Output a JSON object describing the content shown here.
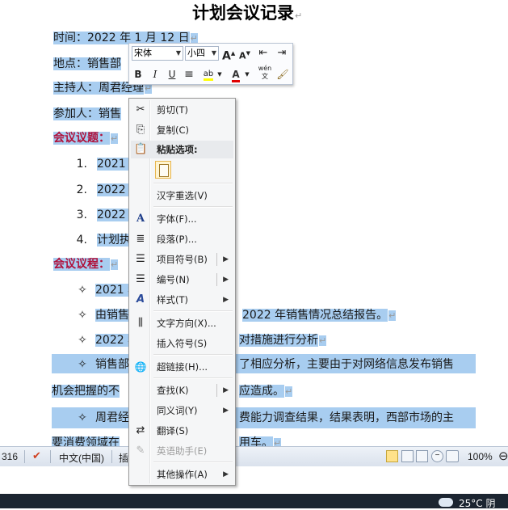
{
  "document": {
    "title": "计划会议记录",
    "time_line": "时间：2022 年 1 月 12 日",
    "location_line": "地点：销售部",
    "host_line": "主持人：周君经理",
    "attendees_line": "参加人：销售",
    "agenda_heading": "会议议题：",
    "agenda_items": [
      {
        "num": "1.",
        "text": "2021 年"
      },
      {
        "num": "2.",
        "text": "2022 年"
      },
      {
        "num": "3.",
        "text": "2022 年"
      },
      {
        "num": "4.",
        "text": "计划执"
      }
    ],
    "process_heading": "会议议程：",
    "process_items": [
      {
        "bullet": "✧",
        "text": "2021 年"
      },
      {
        "bullet": "✧",
        "text": "由销售部",
        "tail": "2022 年销售情况总结报告。"
      },
      {
        "bullet": "✧",
        "text": "2022 年",
        "tail": "对措施进行分析"
      },
      {
        "bullet": "✧",
        "text": "销售部",
        "tail": "了相应分析，主要由于对网络信息发布销售"
      },
      {
        "bullet": "",
        "text": "机会把握的不",
        "tail": "应造成。"
      },
      {
        "bullet": "✧",
        "text": "周君经",
        "tail": "费能力调查结果，结果表明，西部市场的主"
      },
      {
        "bullet": "",
        "text": "要消费领域在",
        "tail": "用车。"
      }
    ],
    "para_mark": "↵"
  },
  "mini_toolbar": {
    "font_name": "宋体",
    "font_size": "小四",
    "grow_font": "A",
    "shrink_font": "A",
    "bold": "B",
    "italic": "I",
    "underline": "U",
    "highlight": "ab",
    "font_color": "A",
    "phonetic": "wén",
    "format_painter": "🖌"
  },
  "context_menu": {
    "items": [
      {
        "label": "剪切(T)",
        "icon": "scissors-icon",
        "glyph": "✂"
      },
      {
        "label": "复制(C)",
        "icon": "copy-icon",
        "glyph": "⎘"
      },
      {
        "label": "粘贴选项:",
        "icon": "paste-icon",
        "glyph": "📋"
      },
      {
        "label": "汉字重选(V)"
      },
      {
        "label": "字体(F)...",
        "icon": "font-icon",
        "glyph": "A"
      },
      {
        "label": "段落(P)...",
        "icon": "paragraph-icon",
        "glyph": "≣"
      },
      {
        "label": "项目符号(B)",
        "icon": "bullets-icon",
        "glyph": "☰"
      },
      {
        "label": "编号(N)",
        "icon": "numbering-icon",
        "glyph": "☰"
      },
      {
        "label": "样式(T)",
        "icon": "styles-icon",
        "glyph": "A"
      },
      {
        "label": "文字方向(X)...",
        "icon": "text-direction-icon",
        "glyph": "⫼"
      },
      {
        "label": "插入符号(S)"
      },
      {
        "label": "超链接(H)...",
        "icon": "hyperlink-icon",
        "glyph": "🌐"
      },
      {
        "label": "查找(K)"
      },
      {
        "label": "同义词(Y)"
      },
      {
        "label": "翻译(S)",
        "icon": "translate-icon",
        "glyph": "⇄"
      },
      {
        "label": "英语助手(E)",
        "icon": "english-assistant-icon",
        "glyph": "✎"
      },
      {
        "label": "其他操作(A)"
      }
    ],
    "arrow": "▶"
  },
  "status_bar": {
    "word_count": "316",
    "language": "中文(中国)",
    "insert_mode": "插",
    "zoom": "100%"
  },
  "taskbar": {
    "weather": "25°C 阴"
  }
}
